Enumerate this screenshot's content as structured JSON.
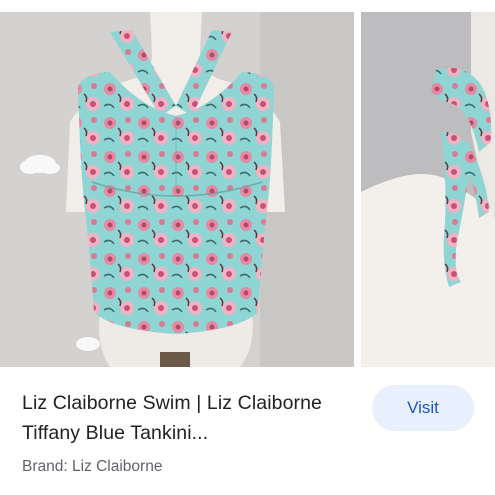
{
  "product": {
    "title": "Liz Claiborne Swim | Liz Claiborne Tiffany Blue Tankini...",
    "brand_line": "Brand: Liz Claiborne",
    "visit_label": "Visit"
  },
  "images": [
    {
      "subject": "tankini top on mannequin",
      "icon": "product-photo"
    },
    {
      "subject": "halter tie closeup",
      "icon": "product-photo"
    }
  ],
  "colors": {
    "fabric": "#8fd5d3",
    "flower": "#e58aa3",
    "visit_bg": "#e8f0fe",
    "visit_text": "#1a56c4"
  }
}
